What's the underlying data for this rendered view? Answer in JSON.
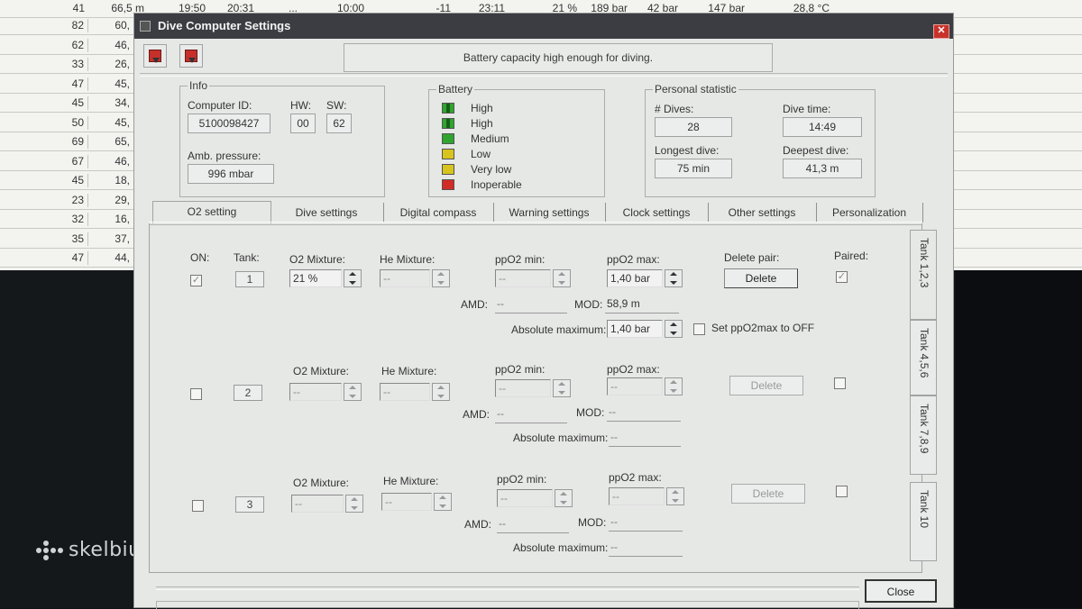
{
  "spreadsheet": {
    "top_row": [
      "41",
      "66,5 m",
      "19:50",
      "20:31",
      "...",
      "10:00",
      "-11",
      "23:11",
      "21 %",
      "189 bar",
      "42 bar",
      "147 bar",
      "28,8 °C"
    ],
    "rows": [
      [
        "82",
        "60,"
      ],
      [
        "62",
        "46,"
      ],
      [
        "33",
        "26,"
      ],
      [
        "47",
        "45,"
      ],
      [
        "45",
        "34,"
      ],
      [
        "50",
        "45,"
      ],
      [
        "69",
        "65,"
      ],
      [
        "67",
        "46,"
      ],
      [
        "45",
        "18,"
      ],
      [
        "23",
        "29,"
      ],
      [
        "32",
        "16,"
      ],
      [
        "35",
        "37,"
      ],
      [
        "47",
        "44,"
      ]
    ]
  },
  "watermark": "skelbiu.lt",
  "dialog": {
    "title": "Dive Computer Settings",
    "close_icon": "close-icon",
    "status": "Battery capacity high enough for diving.",
    "info": {
      "title": "Info",
      "computer_id_label": "Computer ID:",
      "computer_id": "5100098427",
      "hw_label": "HW:",
      "hw": "00",
      "sw_label": "SW:",
      "sw": "62",
      "amb_pressure_label": "Amb. pressure:",
      "amb_pressure": "996 mbar"
    },
    "battery": {
      "title": "Battery",
      "levels": [
        {
          "label": "High",
          "color": "#2fa52f"
        },
        {
          "label": "High",
          "color": "#2fa52f"
        },
        {
          "label": "Medium",
          "color": "#2fa52f"
        },
        {
          "label": "Low",
          "color": "#d8c41e"
        },
        {
          "label": "Very low",
          "color": "#d8c41e"
        },
        {
          "label": "Inoperable",
          "color": "#d22d25"
        }
      ]
    },
    "personal": {
      "title": "Personal statistic",
      "dives_label": "# Dives:",
      "dives": "28",
      "dive_time_label": "Dive time:",
      "dive_time": "14:49",
      "longest_label": "Longest dive:",
      "longest": "75 min",
      "deepest_label": "Deepest dive:",
      "deepest": "41,3 m"
    },
    "tabs": [
      "O2 setting",
      "Dive settings",
      "Digital compass",
      "Warning settings",
      "Clock settings",
      "Other settings",
      "Personalization"
    ],
    "side_tabs": [
      "Tank 1,2,3",
      "Tank 4,5,6",
      "Tank 7,8,9",
      "Tank 10"
    ],
    "headers": {
      "on": "ON:",
      "tank": "Tank:",
      "o2": "O2 Mixture:",
      "he": "He Mixture:",
      "ppo2min": "ppO2 min:",
      "ppo2max": "ppO2 max:",
      "delete_pair": "Delete pair:",
      "paired": "Paired:",
      "amd": "AMD:",
      "mod": "MOD:",
      "abs_max": "Absolute maximum:",
      "set_off": "Set ppO2max to OFF"
    },
    "tank1": {
      "num": "1",
      "on": "✓",
      "o2": "21 %",
      "he": "--",
      "ppo2min": "--",
      "ppo2max": "1,40 bar",
      "delete": "Delete",
      "paired": "✓",
      "amd": "--",
      "mod": "58,9 m",
      "abs_max": "1,40 bar"
    },
    "tank2": {
      "num": "2",
      "o2": "--",
      "he": "--",
      "ppo2min": "--",
      "ppo2max": "--",
      "delete": "Delete",
      "amd": "--",
      "mod": "--",
      "abs_max": "--"
    },
    "tank3": {
      "num": "3",
      "o2": "--",
      "he": "--",
      "ppo2min": "--",
      "ppo2max": "--",
      "delete": "Delete",
      "amd": "--",
      "mod": "--",
      "abs_max": "--"
    },
    "close_label": "Close"
  }
}
